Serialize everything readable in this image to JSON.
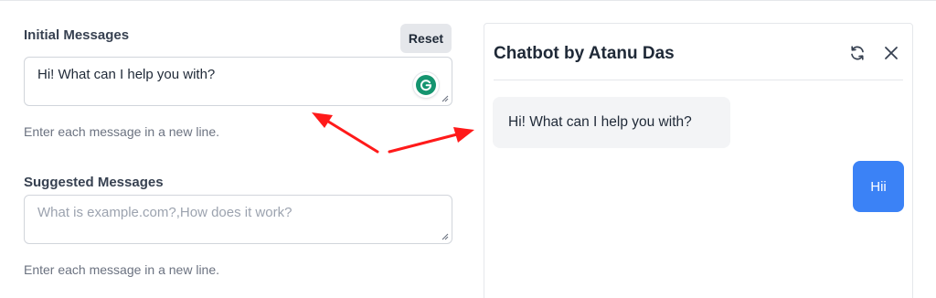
{
  "initial_messages": {
    "label": "Initial Messages",
    "value": "Hi! What can I help you with?",
    "helper": "Enter each message in a new line."
  },
  "reset_button": {
    "label": "Reset"
  },
  "suggested_messages": {
    "label": "Suggested Messages",
    "placeholder": "What is example.com?,How does it work?",
    "helper": "Enter each message in a new line."
  },
  "chat": {
    "title": "Chatbot by Atanu Das",
    "messages": [
      {
        "role": "bot",
        "text": "Hi! What can I help you with?"
      },
      {
        "role": "user",
        "text": "Hii"
      }
    ]
  },
  "icons": {
    "refresh": "refresh-icon",
    "close": "close-icon",
    "grammarly": "grammarly-icon"
  },
  "colors": {
    "user_bubble": "#3b82f6",
    "bot_bubble": "#f3f4f6",
    "annotation_arrow": "#ff1a1a",
    "grammarly": "#15946f"
  }
}
